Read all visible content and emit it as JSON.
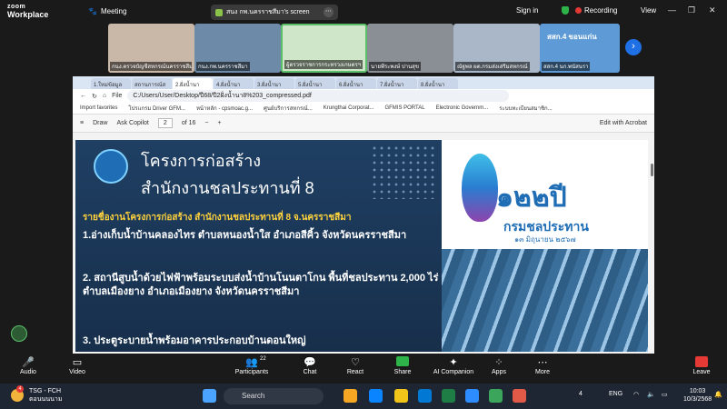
{
  "app": {
    "logo_top": "zoom",
    "logo_bottom": "Workplace",
    "meeting_tab": "Meeting"
  },
  "share_pill": {
    "label": "สนง กพ.นครราชสีมา's screen"
  },
  "top_right": {
    "signin": "Sign in",
    "recording": "Recording",
    "view": "View"
  },
  "gallery": [
    {
      "label": "กนง.ตรวจบัญชีสหกรณ์นครราชสีมา",
      "bg": "#c9b8a8"
    },
    {
      "label": "กนง.กพ.นครราชสีมา",
      "bg": "#6d8aa8"
    },
    {
      "label": "ผู้ตรวจราชการกระทรวงเกษตรฯ",
      "bg": "#cfe6c9"
    },
    {
      "label": "นายพีระพงษ์ ปานสุข",
      "bg": "#8a8f96"
    },
    {
      "label": "ณัฐพล ผต.กรมส่งเสริมสหกรณ์",
      "bg": "#a9b7c8"
    },
    {
      "label": "สสก.4 นก.พนัสนรา",
      "bg": "#5e9bd6"
    }
  ],
  "gallery_overlay": {
    "line1": "สสก.4 ขอนแก่น",
    "line2": ""
  },
  "browser": {
    "tabs": [
      "1.ใหม่ข้อมูล",
      "สถานการณ์ส",
      "2.ฝั่งน้ำนา",
      "4.ฝั่งน้ำนา",
      "3.ฝั่งน้ำนา",
      "5.ฝั่งน้ำนา",
      "6.ฝั่งน้ำนา",
      "7.ฝั่งน้ำนา",
      "8.ฝั่งน้ำนา"
    ],
    "url_prefix": "File",
    "url": "C:/Users/User/Desktop/ปี68/ปี2ฝั่งน้ำนา8%203_compressed.pdf",
    "favorites": [
      "Import favorites",
      "โปรแกรม Driver GFM...",
      "หน้าหลัก - cpsmoac.g...",
      "ศูนย์บริการสหกรณ์...",
      "Krungthai Corporat...",
      "GFMIS PORTAL",
      "Electronic Governm...",
      "ระบบทะเบียนสมาชิก..."
    ],
    "pdf": {
      "draw": "Draw",
      "ask": "Ask Copilot",
      "page": "2",
      "of": "of 16",
      "edit": "Edit with Acrobat"
    }
  },
  "slide": {
    "title_line1": "โครงการก่อสร้าง",
    "title_line2": "สำนักงานชลประทานที่ 8",
    "subtitle": "รายชื่องานโครงการก่อสร้าง สำนักงานชลประทานที่ 8 จ.นครราชสีมา",
    "items": [
      "1.อ่างเก็บน้ำบ้านคลองไทร ตำบลหนองน้ำใส อำเภอสีคิ้ว จังหวัดนครราชสีมา",
      "2. สถานีสูบน้ำด้วยไฟฟ้าพร้อมระบบส่งน้ำบ้านโนนตาโกน พื้นที่ชลประทาน 2,000 ไร่ ตำบลเมืองยาง อำเภอเมืองยาง จังหวัดนครราชสีมา",
      "3. ประตูระบายน้ำพร้อมอาคารประกอบบ้านดอนใหญ่"
    ],
    "logo_number": "๑๒๒ปี",
    "logo_org": "กรมชลประทาน",
    "logo_date": "๑๓ มิถุนายน ๒๕๖๗"
  },
  "controls": {
    "audio": "Audio",
    "video": "Video",
    "participants": "Participants",
    "participants_count": "22",
    "chat": "Chat",
    "react": "React",
    "share": "Share",
    "ai": "AI Companion",
    "apps": "Apps",
    "more": "More",
    "leave": "Leave"
  },
  "taskbar": {
    "weather_line1": "TSG - FCH",
    "weather_line2": "ตอนนนนาม",
    "badge": "4",
    "search": "Search",
    "lang": "ENG",
    "time": "10:03",
    "date": "10/3/2568",
    "notif": "4"
  }
}
